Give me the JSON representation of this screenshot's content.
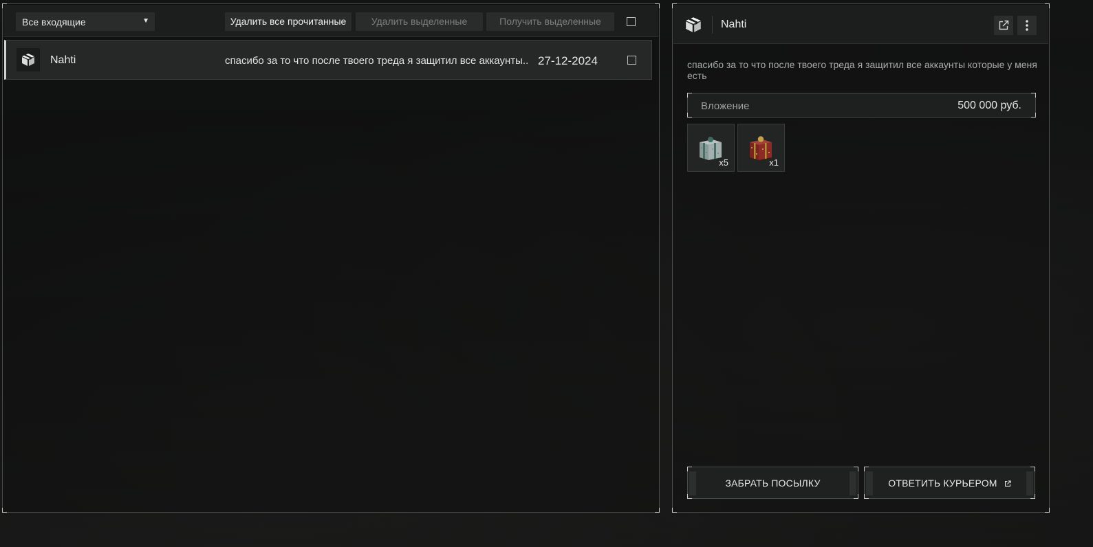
{
  "inbox": {
    "filter_value": "Все входящие",
    "buttons": {
      "delete_read": "Удалить все прочитанные",
      "delete_selected": "Удалить выделенные",
      "receive_selected": "Получить выделенные"
    },
    "messages": [
      {
        "sender": "Nahti",
        "preview": "спасибо за то что после твоего треда я защитил все аккаунты..",
        "date": "27-12-2024"
      }
    ]
  },
  "detail": {
    "sender": "Nahti",
    "body": "спасибо за то что после твоего треда я защитил все аккаунты которые у меня есть",
    "attachment": {
      "label": "Вложение",
      "value": "500 000 руб."
    },
    "items": [
      {
        "icon": "gift-box-icon",
        "qty": "x5",
        "color": "#8a9a98"
      },
      {
        "icon": "gift-box-icon",
        "qty": "x1",
        "color": "#8e2a25"
      }
    ],
    "actions": {
      "take": "ЗАБРАТЬ ПОСЫЛКУ",
      "reply": "ОТВЕТИТЬ КУРЬЕРОМ"
    }
  }
}
